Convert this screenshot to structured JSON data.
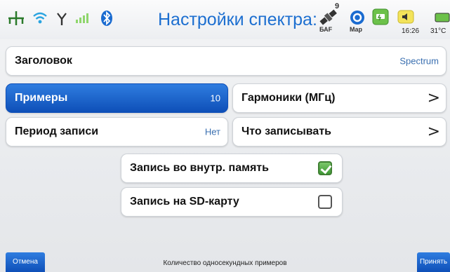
{
  "status_bar": {
    "title": "Настройки спектра:",
    "sat_count": "9",
    "sat_label": "БАF",
    "map_label": "Map",
    "time": "16:26",
    "temperature": "31°C",
    "icons": [
      "network-icon",
      "wifi-icon",
      "antenna-icon",
      "signal-icon",
      "bluetooth-icon",
      "satellite-icon",
      "map-icon",
      "battery-status-icon",
      "speaker-icon",
      "battery-icon"
    ]
  },
  "rows": {
    "title_row": {
      "label": "Заголовок",
      "value": "Spectrum"
    },
    "samples": {
      "label": "Примеры",
      "value": "10",
      "selected": true
    },
    "harmonics": {
      "label": "Гармоники (МГц)"
    },
    "record_period": {
      "label": "Период записи",
      "value": "Нет"
    },
    "what_to_record": {
      "label": "Что записывать"
    },
    "internal_memory": {
      "label": "Запись во внутр. память",
      "checked": true
    },
    "sd_card": {
      "label": "Запись на SD-карту",
      "checked": false
    }
  },
  "bottom": {
    "cancel_label": "Отмена",
    "hint": "Количество односекундных примеров",
    "accept_label": "Принять"
  },
  "colors": {
    "accent": "#1d6fd0",
    "selected_row": "#0e4fb8",
    "check_green": "#3f9a35"
  }
}
